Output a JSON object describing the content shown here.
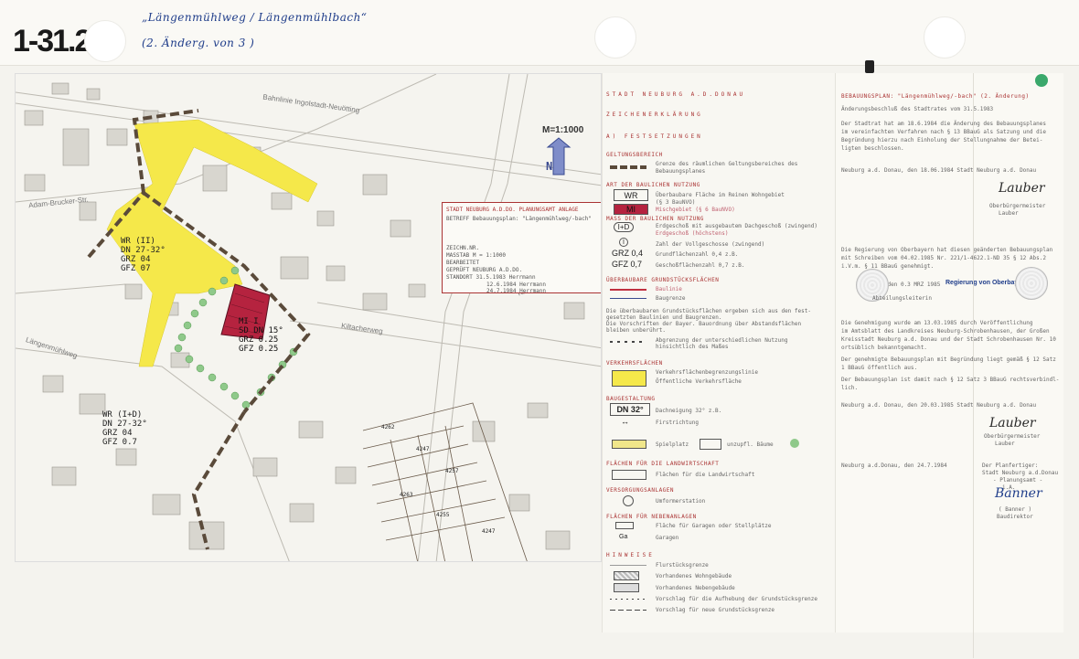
{
  "header": {
    "plan_id": "1-31.2",
    "handwritten_title": "„Längenmühlweg / Längenmühlbach“",
    "handwritten_subtitle": "(2. Änderg. von 3 )"
  },
  "map": {
    "scale_label": "M=1:1000",
    "north_label": "N",
    "streets": [
      "Bahnlinie Ingolstadt-Neuötting",
      "Adam-Brucker-Str.",
      "Längenmühlweg",
      "Kiltacherweg",
      "Kiltacherweg"
    ],
    "zone_west_top": [
      "WR (II)",
      "DN 27-32°",
      "GRZ 04",
      "GFZ 07"
    ],
    "zone_west_bottom": [
      "WR (I+D)",
      "DN 27-32°",
      "GRZ 04",
      "GFZ 0.7"
    ],
    "zone_center": [
      "MI I",
      "SD DN 15°",
      "GRZ 0.25",
      "GFZ 0.25"
    ],
    "lot_numbers": [
      "4262",
      "4247",
      "4257",
      "4263",
      "4255",
      "4247"
    ],
    "title_block": {
      "authority": "STADT NEUBURG A.D.DO. PLANUNGSAMT",
      "annex": "ANLAGE",
      "subject_label": "BETREFF",
      "subject": "Bebauungsplan: \"Längenmühlweg/-bach\"",
      "drawing_no_label": "ZEICHN.NR.",
      "scale_label": "MASSTAB",
      "scale": "M = 1:1000",
      "editor_label": "BEARBEITET",
      "checked_label": "GEPRÜFT",
      "status_label": "STANDORT",
      "place": "NEUBURG A.D.DO.",
      "dates": [
        "31.5.1983 Herrmann",
        "12.6.1984 Herrmann",
        "24.7.1984 Herrmann"
      ]
    }
  },
  "legend": {
    "authority": "STADT NEUBURG A.D.DONAU",
    "heading": "ZEICHENERKLÄRUNG",
    "section_a": "A) FESTSETZUNGEN",
    "geltungsbereich_head": "GELTUNGSBEREICH",
    "geltungsbereich_text": [
      "Grenze des räumlichen Geltungsbereiches des",
      "Bebauungsplanes"
    ],
    "nutzung_head": "ART DER BAULICHEN NUTZUNG",
    "wr_symbol": "WR",
    "wr_text": [
      "Überbaubare Fläche im Reinen Wohngebiet",
      "(§ 3 BauNVO)"
    ],
    "mi_symbol": "MI",
    "mi_text": "Mischgebiet (§ 6 BauNVO)",
    "mass_head": "MASS DER BAULICHEN NUTZUNG",
    "id_symbol": "I+D",
    "id_text": [
      "Erdgeschoß mit ausgebautem Dachgeschoß (zwingend)",
      "Erdgeschoß (höchstens)"
    ],
    "i_symbol": "I",
    "i_text": "Zahl der Vollgeschosse (zwingend)",
    "grz_symbol": "GRZ 0,4",
    "grz_text": "Grundflächenzahl 0,4 z.B.",
    "gfz_symbol": "GFZ 0,7",
    "gfz_text": "Geschoßflächenzahl 0,7 z.B.",
    "ueberbaubar_head": "ÜBERBAUBARE GRUNDSTÜCKSFLÄCHEN",
    "baulinie": "Baulinie",
    "baugrenze": "Baugrenze",
    "note_text": [
      "Die überbaubaren Grundstücksflächen ergeben sich aus den fest-",
      "gesetzten Baulinien und Baugrenzen.",
      "Die Vorschriften der Bayer. Bauordnung über Abstandsflächen",
      "bleiben unberührt."
    ],
    "abgrenzung": [
      "Abgrenzung der unterschiedlichen Nutzung",
      "hinsichtlich des Maßes"
    ],
    "verkehr_head": "VERKEHRSFLÄCHEN",
    "verkehr_text": [
      "Verkehrsflächenbegrenzungslinie",
      "Öffentliche Verkehrsfläche"
    ],
    "bauweise_head": "BAUGESTALTUNG",
    "dn_symbol": "DN 32°",
    "dn_text": "Dachneigung 32° z.B.",
    "first_text": "Firstrichtung",
    "spiel_text": "Spielplatz",
    "spiel_extra": "unzupfl. Bäume",
    "landwirt_head": "FLÄCHEN FÜR DIE LANDWIRTSCHAFT",
    "landwirt_text": "Flächen für die Landwirtschaft",
    "versorgung_head": "VERSORGUNGSANLAGEN",
    "versorgung_text": "Umformerstation",
    "nebenanlage_head": "FLÄCHEN FÜR NEBENANLAGEN",
    "garagen_text": "Fläche für Garagen oder Stellplätze",
    "ga_symbol": "Ga",
    "ga_text": "Garagen",
    "hinweise_head": "HINWEISE",
    "hinweise": [
      "Flurstücksgrenze",
      "Vorhandenes Wohngebäude",
      "Vorhandenes Nebengebäude",
      "Vorschlag für die Aufhebung der Grundstücksgrenze",
      "Vorschlag für neue Grundstücksgrenze"
    ]
  },
  "procedures": {
    "heading": "BEBAUUNGSPLAN: \"Längenmühlweg/-bach\" (2. Änderung)",
    "line1": "Änderungsbeschluß des Stadtrates vom 31.5.1983",
    "para1": [
      "Der Stadtrat hat am 18.6.1984 die Änderung des Bebauungsplanes",
      "im vereinfachten Verfahren nach § 13 BBauG als Satzung und die",
      "Begründung hierzu nach Einholung der Stellungnahme der Betei-",
      "ligten beschlossen."
    ],
    "place_date1": "Neuburg a.d. Donau, den 18.06.1984 Stadt Neuburg a.d. Donau",
    "sig1": "Lauber",
    "role1": [
      "Oberbürgermeister",
      "Lauber"
    ],
    "para2": [
      "Die Regierung von Oberbayern hat diesen geänderten Bebauungsplan",
      "mit Schreiben vom 04.02.1985 Nr. 221/1-4622.1-ND 35 § 12 Abs.2",
      "i.V.m. § 11 BBauG genehmigt."
    ],
    "place_date2": "München, den 0.3 MRZ 1985",
    "stamp_label": "Regierung von Oberbayern",
    "stamp_sub": "Abteilungsleiterin",
    "para3": [
      "Die Genehmigung wurde am 13.03.1985 durch Veröffentlichung",
      "im Amtsblatt des Landkreises Neuburg-Schrobenhausen, der Großen",
      "Kreisstadt Neuburg a.d. Donau und der Stadt Schrobenhausen Nr. 10",
      "ortsüblich bekanntgemacht."
    ],
    "para4": [
      "Der genehmigte Bebauungsplan mit Begründung liegt gemäß § 12 Satz",
      "1 BBauG öffentlich aus."
    ],
    "para5": [
      "Der Bebauungsplan ist damit nach § 12 Satz 3 BBauG rechtsverbindl-",
      "lich."
    ],
    "place_date3": "Neuburg a.d. Donau, den 20.03.1985 Stadt Neuburg a.d. Donau",
    "sig2": "Lauber",
    "role2": [
      "Oberbürgermeister",
      "Lauber"
    ],
    "place_date4": "Neuburg a.d.Donau, den 24.7.1984",
    "planner": [
      "Der Planfertiger:",
      "Stadt Neuburg a.d.Donau",
      "- Planungsamt -",
      "i.A."
    ],
    "sig3": "Banner",
    "role3": [
      "( Banner )",
      "Baudirektor"
    ]
  },
  "colors": {
    "yellow": "#f5e84a",
    "mi_red": "#b5233f",
    "border_dash": "#5a4a3a",
    "green": "#8fc98a",
    "blue_ink": "#1f3d8a"
  }
}
